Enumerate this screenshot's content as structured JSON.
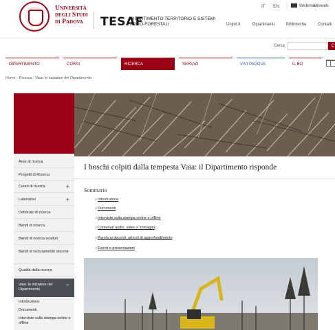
{
  "header": {
    "university": [
      "Università",
      "degli Studi",
      "di Padova"
    ],
    "dept_logo": "TESAF",
    "dept_name": [
      "DIPARTIMENTO TERRITORIO E SISTEMI",
      "AGRO-FORESTALI"
    ],
    "lang": [
      "IT",
      "EN"
    ],
    "webmail": "Webmail",
    "unilink": "Uniweb",
    "top_links": [
      "Unipd.it",
      "Dipartimenti",
      "Biblioteche",
      "Contatti"
    ]
  },
  "search": {
    "label": "Cerca",
    "placeholder": "",
    "button": "C"
  },
  "nav": {
    "items": [
      "DIPARTIMENTO",
      "CORSI",
      "RICERCA",
      "SERVIZI",
      "VIVI PADOVA",
      "IL BO"
    ]
  },
  "breadcrumb": "Home - Ricerca - Vaia: le iniziative del Dipartimento",
  "sidebar": {
    "items": [
      "Aree di ricerca",
      "Progetti di Ricerca",
      "Centri di ricerca",
      "Laboratori",
      "Dottorato di ricerca",
      "Bandi di ricerca",
      "Bandi di ricerca scaduti",
      "Bandi di reclutamento docenti",
      "Qualità della ricerca"
    ],
    "plus": [
      "+",
      "+"
    ],
    "active_label": "Vaia: le iniziative del Dipartimento",
    "active_toggle": "−",
    "sub_items": [
      "Introduzione",
      "Documenti",
      "Interviste sulla stampa online e offline"
    ]
  },
  "content": {
    "title": "I boschi colpiti dalla tempesta Vaia: il Dipartimento risponde",
    "summary_heading": "Sommario",
    "toc": [
      "Introduzione",
      "Documenti",
      "Interviste sulla stampa online e offline",
      "Contenuti audio, video e immagini",
      "Parola ai docenti: articoli di approfondimento",
      "Eventi e presentazioni"
    ]
  },
  "colors": {
    "brand": "#9b0014",
    "sidebar_active": "#4a4e55",
    "link_blue": "#2a5db0"
  }
}
